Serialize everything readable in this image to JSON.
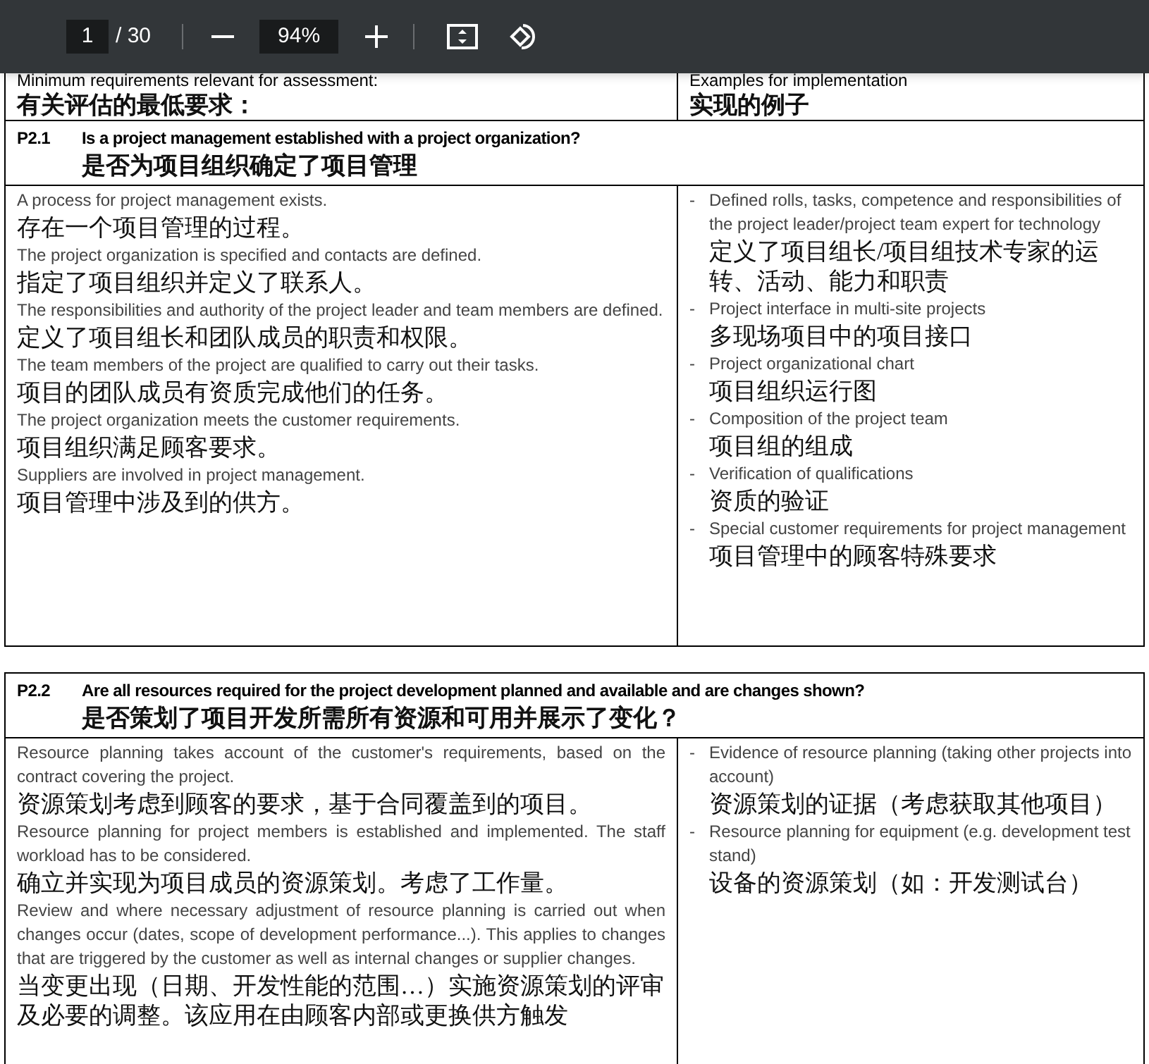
{
  "toolbar": {
    "page_current": "1",
    "page_total": "/ 30",
    "zoom": "94%"
  },
  "table_header": {
    "requirements_en": "Minimum requirements relevant for assessment:",
    "requirements_zh": "有关评估的最低要求：",
    "examples_en": "Examples for implementation",
    "examples_zh": "实现的例子"
  },
  "questions": [
    {
      "number": "P2.1",
      "question_en": "Is a project management established with a project organization?",
      "question_zh": "是否为项目组织确定了项目管理",
      "requirements": [
        {
          "en": "A process for project management exists.",
          "zh": "存在一个项目管理的过程。"
        },
        {
          "en": "The project organization is specified and contacts are defined.",
          "zh": "指定了项目组织并定义了联系人。"
        },
        {
          "en": "The responsibilities and authority of the project leader and team members are defined.",
          "zh": "定义了项目组长和团队成员的职责和权限。"
        },
        {
          "en": "The team members of the project are qualified to carry out their tasks.",
          "zh": "项目的团队成员有资质完成他们的任务。"
        },
        {
          "en": "The project organization meets the customer requirements.",
          "zh": "项目组织满足顾客要求。"
        },
        {
          "en": "Suppliers are involved in project management.",
          "zh": "项目管理中涉及到的供方。"
        }
      ],
      "examples": [
        {
          "marker": "-",
          "en": "Defined rolls, tasks, competence and responsibilities of the project leader/project team expert for technology",
          "zh": "定义了项目组长/项目组技术专家的运转、活动、能力和职责"
        },
        {
          "marker": "-",
          "en": "Project interface in multi-site projects",
          "zh": "多现场项目中的项目接口"
        },
        {
          "marker": "-",
          "en": "Project organizational chart",
          "zh": "项目组织运行图"
        },
        {
          "marker": "-",
          "en": "Composition of the project team",
          "zh": "项目组的组成"
        },
        {
          "marker": "-",
          "en": "Verification of qualifications",
          "zh": "资质的验证"
        },
        {
          "marker": "-",
          "en": "Special customer requirements for project management",
          "zh": "项目管理中的顾客特殊要求"
        }
      ]
    },
    {
      "number": "P2.2",
      "question_en": "Are all resources required for the project development planned and available and are changes shown?",
      "question_zh": "是否策划了项目开发所需所有资源和可用并展示了变化？",
      "requirements": [
        {
          "en": "Resource planning takes account of the customer's requirements, based on the contract covering the project.",
          "zh": "资源策划考虑到顾客的要求，基于合同覆盖到的项目。"
        },
        {
          "en": "Resource planning for project members is established and implemented. The staff workload has to be considered.",
          "zh": "确立并实现为项目成员的资源策划。考虑了工作量。"
        },
        {
          "en": "Review and where necessary adjustment of resource planning is carried out when changes occur (dates, scope of development performance...). This applies to changes that are triggered by the customer as well as internal changes or supplier changes.",
          "zh": "当变更出现（日期、开发性能的范围…）实施资源策划的评审及必要的调整。该应用在由顾客内部或更换供方触发"
        }
      ],
      "examples": [
        {
          "marker": "-",
          "en": "Evidence of resource planning (taking other projects into account)",
          "zh": "资源策划的证据（考虑获取其他项目）"
        },
        {
          "marker": "-",
          "en": "Resource planning for equipment (e.g. development test stand)",
          "zh": "设备的资源策划（如：开发测试台）"
        }
      ]
    }
  ]
}
